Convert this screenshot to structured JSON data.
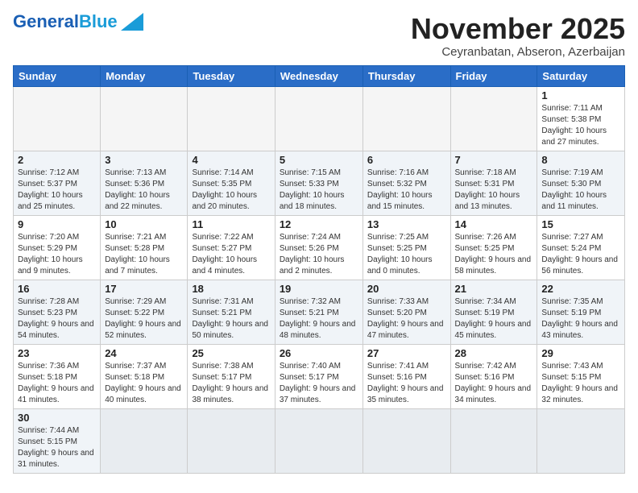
{
  "header": {
    "logo_general": "General",
    "logo_blue": "Blue",
    "month_title": "November 2025",
    "location": "Ceyranbatan, Abseron, Azerbaijan"
  },
  "days_of_week": [
    "Sunday",
    "Monday",
    "Tuesday",
    "Wednesday",
    "Thursday",
    "Friday",
    "Saturday"
  ],
  "weeks": [
    [
      {
        "day": "",
        "info": ""
      },
      {
        "day": "",
        "info": ""
      },
      {
        "day": "",
        "info": ""
      },
      {
        "day": "",
        "info": ""
      },
      {
        "day": "",
        "info": ""
      },
      {
        "day": "",
        "info": ""
      },
      {
        "day": "1",
        "info": "Sunrise: 7:11 AM\nSunset: 5:38 PM\nDaylight: 10 hours and 27 minutes."
      }
    ],
    [
      {
        "day": "2",
        "info": "Sunrise: 7:12 AM\nSunset: 5:37 PM\nDaylight: 10 hours and 25 minutes."
      },
      {
        "day": "3",
        "info": "Sunrise: 7:13 AM\nSunset: 5:36 PM\nDaylight: 10 hours and 22 minutes."
      },
      {
        "day": "4",
        "info": "Sunrise: 7:14 AM\nSunset: 5:35 PM\nDaylight: 10 hours and 20 minutes."
      },
      {
        "day": "5",
        "info": "Sunrise: 7:15 AM\nSunset: 5:33 PM\nDaylight: 10 hours and 18 minutes."
      },
      {
        "day": "6",
        "info": "Sunrise: 7:16 AM\nSunset: 5:32 PM\nDaylight: 10 hours and 15 minutes."
      },
      {
        "day": "7",
        "info": "Sunrise: 7:18 AM\nSunset: 5:31 PM\nDaylight: 10 hours and 13 minutes."
      },
      {
        "day": "8",
        "info": "Sunrise: 7:19 AM\nSunset: 5:30 PM\nDaylight: 10 hours and 11 minutes."
      }
    ],
    [
      {
        "day": "9",
        "info": "Sunrise: 7:20 AM\nSunset: 5:29 PM\nDaylight: 10 hours and 9 minutes."
      },
      {
        "day": "10",
        "info": "Sunrise: 7:21 AM\nSunset: 5:28 PM\nDaylight: 10 hours and 7 minutes."
      },
      {
        "day": "11",
        "info": "Sunrise: 7:22 AM\nSunset: 5:27 PM\nDaylight: 10 hours and 4 minutes."
      },
      {
        "day": "12",
        "info": "Sunrise: 7:24 AM\nSunset: 5:26 PM\nDaylight: 10 hours and 2 minutes."
      },
      {
        "day": "13",
        "info": "Sunrise: 7:25 AM\nSunset: 5:25 PM\nDaylight: 10 hours and 0 minutes."
      },
      {
        "day": "14",
        "info": "Sunrise: 7:26 AM\nSunset: 5:25 PM\nDaylight: 9 hours and 58 minutes."
      },
      {
        "day": "15",
        "info": "Sunrise: 7:27 AM\nSunset: 5:24 PM\nDaylight: 9 hours and 56 minutes."
      }
    ],
    [
      {
        "day": "16",
        "info": "Sunrise: 7:28 AM\nSunset: 5:23 PM\nDaylight: 9 hours and 54 minutes."
      },
      {
        "day": "17",
        "info": "Sunrise: 7:29 AM\nSunset: 5:22 PM\nDaylight: 9 hours and 52 minutes."
      },
      {
        "day": "18",
        "info": "Sunrise: 7:31 AM\nSunset: 5:21 PM\nDaylight: 9 hours and 50 minutes."
      },
      {
        "day": "19",
        "info": "Sunrise: 7:32 AM\nSunset: 5:21 PM\nDaylight: 9 hours and 48 minutes."
      },
      {
        "day": "20",
        "info": "Sunrise: 7:33 AM\nSunset: 5:20 PM\nDaylight: 9 hours and 47 minutes."
      },
      {
        "day": "21",
        "info": "Sunrise: 7:34 AM\nSunset: 5:19 PM\nDaylight: 9 hours and 45 minutes."
      },
      {
        "day": "22",
        "info": "Sunrise: 7:35 AM\nSunset: 5:19 PM\nDaylight: 9 hours and 43 minutes."
      }
    ],
    [
      {
        "day": "23",
        "info": "Sunrise: 7:36 AM\nSunset: 5:18 PM\nDaylight: 9 hours and 41 minutes."
      },
      {
        "day": "24",
        "info": "Sunrise: 7:37 AM\nSunset: 5:18 PM\nDaylight: 9 hours and 40 minutes."
      },
      {
        "day": "25",
        "info": "Sunrise: 7:38 AM\nSunset: 5:17 PM\nDaylight: 9 hours and 38 minutes."
      },
      {
        "day": "26",
        "info": "Sunrise: 7:40 AM\nSunset: 5:17 PM\nDaylight: 9 hours and 37 minutes."
      },
      {
        "day": "27",
        "info": "Sunrise: 7:41 AM\nSunset: 5:16 PM\nDaylight: 9 hours and 35 minutes."
      },
      {
        "day": "28",
        "info": "Sunrise: 7:42 AM\nSunset: 5:16 PM\nDaylight: 9 hours and 34 minutes."
      },
      {
        "day": "29",
        "info": "Sunrise: 7:43 AM\nSunset: 5:15 PM\nDaylight: 9 hours and 32 minutes."
      }
    ],
    [
      {
        "day": "30",
        "info": "Sunrise: 7:44 AM\nSunset: 5:15 PM\nDaylight: 9 hours and 31 minutes."
      },
      {
        "day": "",
        "info": ""
      },
      {
        "day": "",
        "info": ""
      },
      {
        "day": "",
        "info": ""
      },
      {
        "day": "",
        "info": ""
      },
      {
        "day": "",
        "info": ""
      },
      {
        "day": "",
        "info": ""
      }
    ]
  ]
}
